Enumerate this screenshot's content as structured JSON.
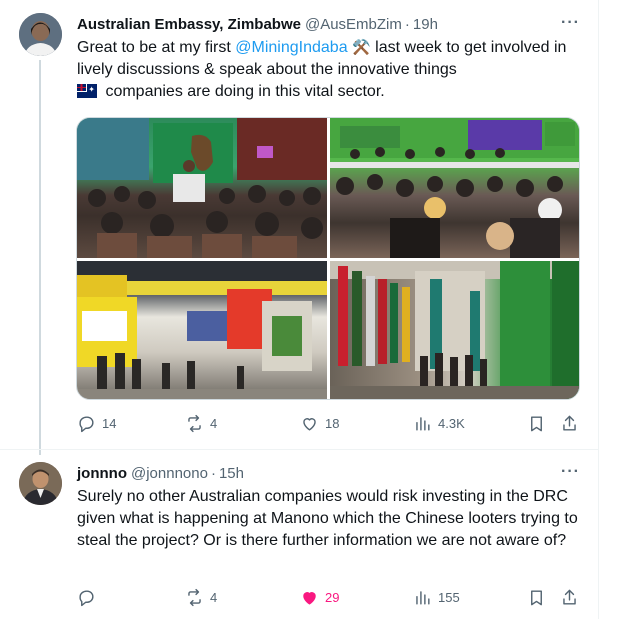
{
  "tweet1": {
    "name": "Australian Embassy, Zimbabwe",
    "handle": "@AusEmbZim",
    "separator": "·",
    "time": "19h",
    "more": "···",
    "text_part1": "Great to be at my first ",
    "mention": "@MiningIndaba",
    "text_part2": " last week to get involved in lively discussions & speak about the innovative things",
    "text_part3": " companies are doing in this vital sector.",
    "emoji_pick": "⚒️",
    "emoji_flag": "australia-flag",
    "stats": {
      "replies": "14",
      "reposts": "4",
      "likes": "18",
      "views": "4.3K"
    }
  },
  "tweet2": {
    "name": "jonnno",
    "handle": "@jonnnono",
    "separator": "·",
    "time": "15h",
    "more": "···",
    "text": "Surely no other Australian companies would risk investing in the DRC given what is happening at Manono which the Chinese looters trying to steal the project? Or is there further information we are not aware of?",
    "stats": {
      "replies": "",
      "reposts": "4",
      "likes": "29",
      "views": "155"
    }
  },
  "colors": {
    "accent": "#1d9bf0",
    "like": "#f91880",
    "secondary_text": "#536471"
  }
}
